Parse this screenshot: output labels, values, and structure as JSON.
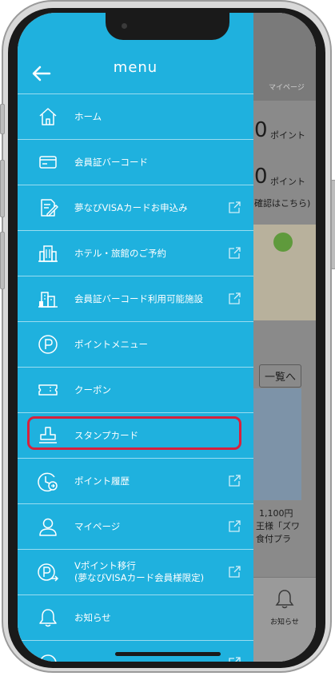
{
  "menu": {
    "title": "menu",
    "items": [
      {
        "label": "ホーム"
      },
      {
        "label": "会員証バーコード"
      },
      {
        "label": "夢なびVISAカードお申込み"
      },
      {
        "label": "ホテル・旅館のご予約"
      },
      {
        "label": "会員証バーコード利用可能施設"
      },
      {
        "label": "ポイントメニュー"
      },
      {
        "label": "クーポン"
      },
      {
        "label": "スタンプカード"
      },
      {
        "label": "ポイント履歴"
      },
      {
        "label": "マイページ"
      },
      {
        "label": "Vポイント移行",
        "label2": "(夢なびVISAカード会員様限定)"
      },
      {
        "label": "お知らせ"
      }
    ]
  },
  "background": {
    "mypage": "マイページ",
    "points1": "0",
    "points1_unit": "ポイント",
    "points2": "0",
    "points2_unit": "ポイント",
    "confirm": "確認はこちら)",
    "list_link": "一覧へ",
    "price": "1,100円",
    "line2": "王様「ズワ",
    "line3": "食付プラ",
    "notice": "お知らせ"
  },
  "colors": {
    "menu_bg": "#1fb1de",
    "highlight": "#d7213d"
  }
}
